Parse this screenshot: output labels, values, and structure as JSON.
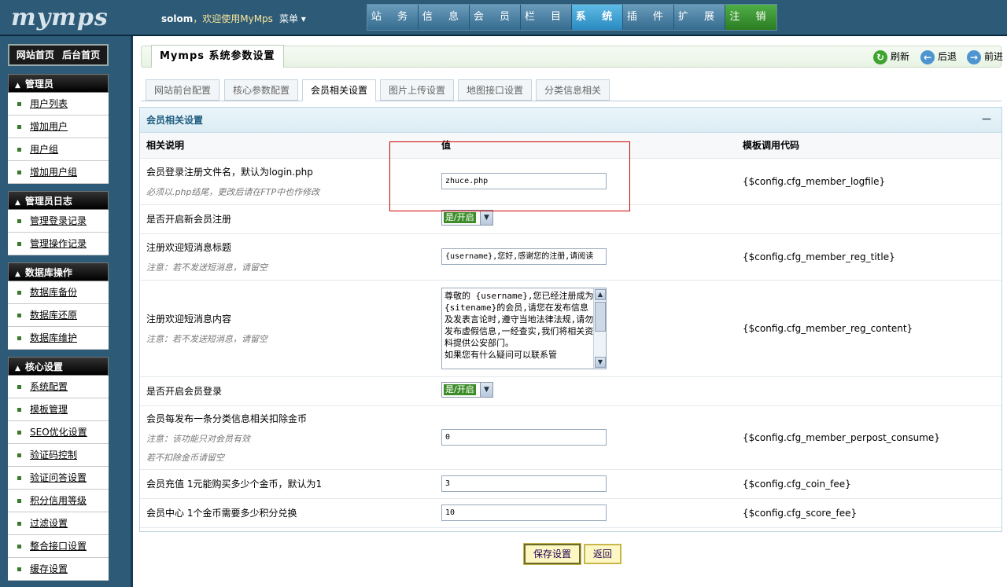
{
  "header": {
    "logo": "mymps",
    "username": "solom",
    "greeting": "，欢迎使用MyMps",
    "menu": "菜单 ▾",
    "nav": [
      "站 务",
      "信 息",
      "会 员",
      "栏 目",
      "系 统",
      "插 件",
      "扩 展",
      "注 销"
    ],
    "active_nav": "系 统"
  },
  "sidebar": {
    "home_links": [
      "网站首页",
      "后台首页"
    ],
    "groups": [
      {
        "title": "管理员",
        "items": [
          "用户列表",
          "增加用户",
          "用户组",
          "增加用户组"
        ]
      },
      {
        "title": "管理员日志",
        "items": [
          "管理登录记录",
          "管理操作记录"
        ]
      },
      {
        "title": "数据库操作",
        "items": [
          "数据库备份",
          "数据库还原",
          "数据库维护"
        ]
      },
      {
        "title": "核心设置",
        "items": [
          "系统配置",
          "模板管理",
          "SEO优化设置",
          "验证码控制",
          "验证问答设置",
          "积分信用等级",
          "过滤设置",
          "整合接口设置",
          "缓存设置"
        ]
      }
    ]
  },
  "page": {
    "title": "Mymps 系统参数设置",
    "tools": {
      "refresh": "刷新",
      "back": "后退",
      "forward": "前进"
    },
    "tabs": [
      "网站前台配置",
      "核心参数配置",
      "会员相关设置",
      "图片上传设置",
      "地图接口设置",
      "分类信息相关"
    ],
    "active_tab": "会员相关设置",
    "panel_title": "会员相关设置",
    "collapse": "－",
    "columns": [
      "相关说明",
      "值",
      "模板调用代码"
    ],
    "rows": {
      "logfile": {
        "label": "会员登录注册文件名，默认为login.php",
        "hint": "必须以.php结尾，更改后请在FTP中也作修改",
        "value": "zhuce.php",
        "code": "{$config.cfg_member_logfile}"
      },
      "open_reg": {
        "label": "是否开启新会员注册",
        "value": "是/开启"
      },
      "reg_title": {
        "label": "注册欢迎短消息标题",
        "hint": "注意：若不发送短消息，请留空",
        "value": "{username},您好,感谢您的注册,请阅读",
        "code": "{$config.cfg_member_reg_title}"
      },
      "reg_content": {
        "label": "注册欢迎短消息内容",
        "hint": "注意：若不发送短消息，请留空",
        "value": "尊敬的 {username},您已经注册成为 {sitename}的会员,请您在发布信息及发表言论时,遵守当地法律法规,请勿发布虚假信息,一经查实,我们将相关资料提供公安部门。\n如果您有什么疑问可以联系管",
        "code": "{$config.cfg_member_reg_content}"
      },
      "open_login": {
        "label": "是否开启会员登录",
        "value": "是/开启"
      },
      "perpost": {
        "label": "会员每发布一条分类信息相关扣除金币",
        "hint": "注意：该功能只对会员有效",
        "hint2": "若不扣除金币请留空",
        "value": "0",
        "code": "{$config.cfg_member_perpost_consume}"
      },
      "coin_fee": {
        "label": "会员充值 1元能购买多少个金币，默认为1",
        "value": "3",
        "code": "{$config.cfg_coin_fee}"
      },
      "score_fee": {
        "label": "会员中心 1个金币需要多少积分兑换",
        "value": "10",
        "code": "{$config.cfg_score_fee}"
      }
    },
    "buttons": {
      "save": "保存设置",
      "back": "返回"
    }
  },
  "colors": {
    "header_bg": "#2c5a77",
    "active_nav": "#2a8ac0",
    "logout_nav": "#2b7c22",
    "highlight": "#d20000"
  }
}
